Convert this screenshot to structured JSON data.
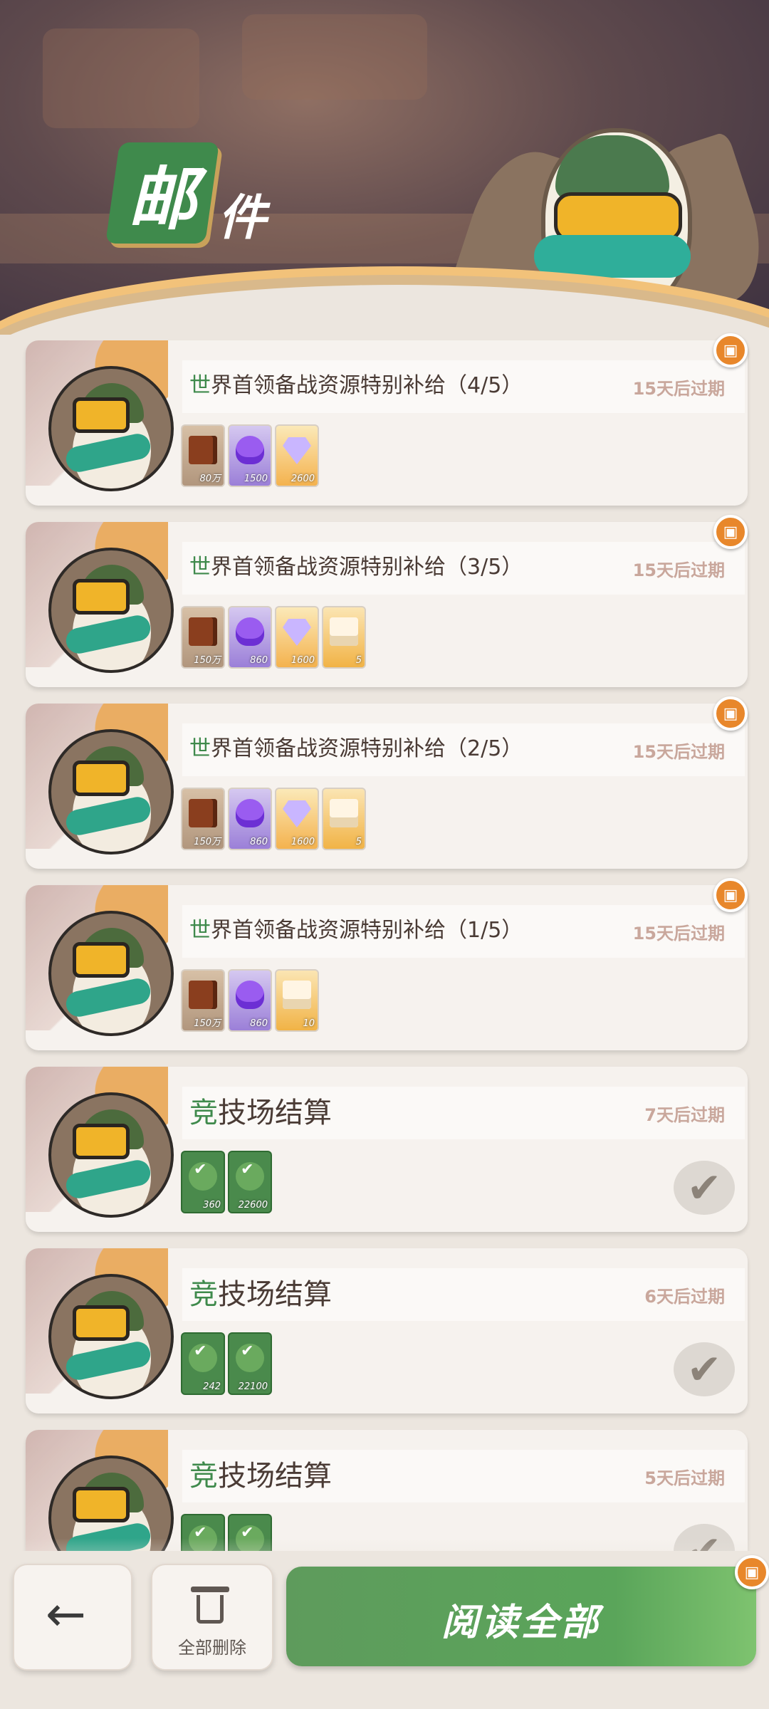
{
  "header": {
    "title_main": "邮",
    "title_sub": "件"
  },
  "mails": [
    {
      "title_first": "世",
      "title_rest": "界首领备战资源特别补给（4/5）",
      "expire": "15天后过期",
      "items": [
        {
          "type": "book",
          "qty": "80万"
        },
        {
          "type": "potion",
          "qty": "1500"
        },
        {
          "type": "gem",
          "qty": "2600"
        }
      ],
      "has_gift": true,
      "is_read": false
    },
    {
      "title_first": "世",
      "title_rest": "界首领备战资源特别补给（3/5）",
      "expire": "15天后过期",
      "items": [
        {
          "type": "book",
          "qty": "150万"
        },
        {
          "type": "potion",
          "qty": "860"
        },
        {
          "type": "gem",
          "qty": "1600"
        },
        {
          "type": "letter",
          "qty": "5"
        }
      ],
      "has_gift": true,
      "is_read": false
    },
    {
      "title_first": "世",
      "title_rest": "界首领备战资源特别补给（2/5）",
      "expire": "15天后过期",
      "items": [
        {
          "type": "book",
          "qty": "150万"
        },
        {
          "type": "potion",
          "qty": "860"
        },
        {
          "type": "gem",
          "qty": "1600"
        },
        {
          "type": "letter",
          "qty": "5"
        }
      ],
      "has_gift": true,
      "is_read": false
    },
    {
      "title_first": "世",
      "title_rest": "界首领备战资源特别补给（1/5）",
      "expire": "15天后过期",
      "items": [
        {
          "type": "book",
          "qty": "150万"
        },
        {
          "type": "potion",
          "qty": "860"
        },
        {
          "type": "letter",
          "qty": "10"
        }
      ],
      "has_gift": true,
      "is_read": false
    },
    {
      "title_first": "竞",
      "title_rest": "技场结算",
      "expire": "7天后过期",
      "items": [
        {
          "type": "token",
          "qty": "360"
        },
        {
          "type": "token",
          "qty": "22600"
        }
      ],
      "has_gift": false,
      "is_read": true
    },
    {
      "title_first": "竞",
      "title_rest": "技场结算",
      "expire": "6天后过期",
      "items": [
        {
          "type": "token",
          "qty": "242"
        },
        {
          "type": "token",
          "qty": "22100"
        }
      ],
      "has_gift": false,
      "is_read": true
    },
    {
      "title_first": "竞",
      "title_rest": "技场结算",
      "expire": "5天后过期",
      "items": [
        {
          "type": "token",
          "qty": ""
        },
        {
          "type": "token",
          "qty": ""
        }
      ],
      "has_gift": false,
      "is_read": true
    }
  ],
  "icons": {
    "gift": "gift-icon",
    "check": "check-icon",
    "back": "back-arrow-icon",
    "trash": "trash-icon"
  },
  "glyphs": {
    "gift": "▣",
    "check": "✔",
    "token_check": "✔",
    "back_arrow": "←"
  },
  "bottom": {
    "delete_all_label": "全部删除",
    "read_all_label": "阅读全部",
    "read_all_has_gift": true
  },
  "colors": {
    "accent_green": "#3f8a4c",
    "gift_orange": "#e8872b",
    "expire_text": "#c9a79c"
  }
}
